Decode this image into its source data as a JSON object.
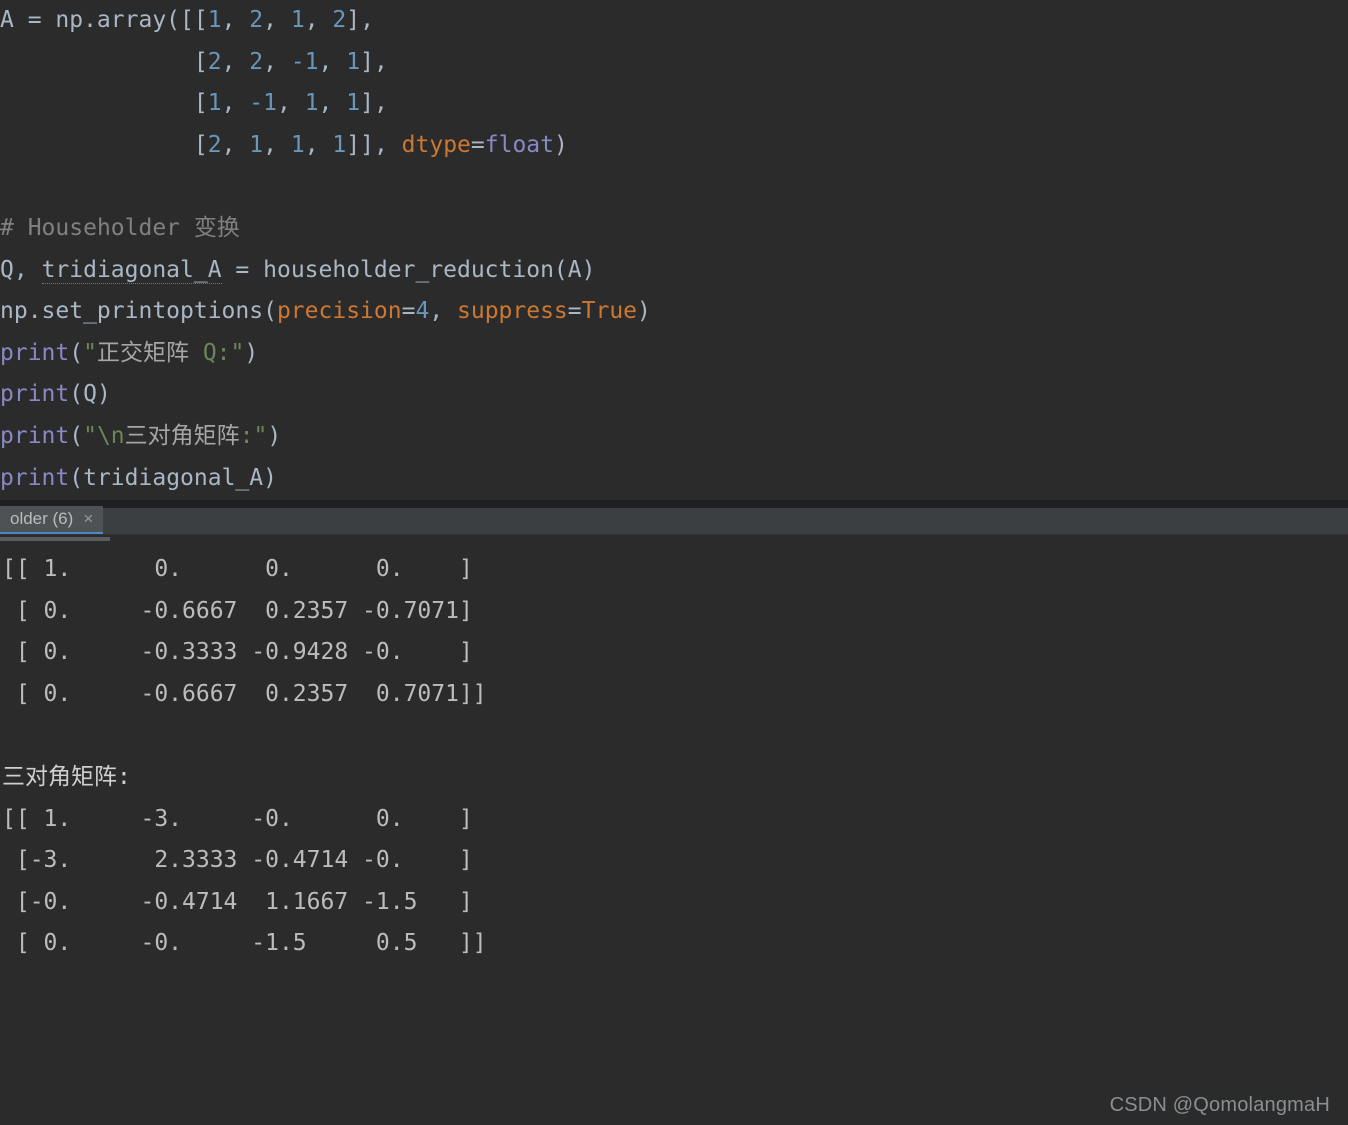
{
  "code": {
    "line1": {
      "prefix": "A = np.array([[",
      "n1": "1",
      "n2": "2",
      "n3": "1",
      "n4": "2",
      "suffix": "],"
    },
    "line2": {
      "pad": "              [",
      "n1": "2",
      "n2": "2",
      "n3": "-1",
      "n4": "1",
      "suffix": "],"
    },
    "line3": {
      "pad": "              [",
      "n1": "1",
      "n2": "-1",
      "n3": "1",
      "n4": "1",
      "suffix": "],"
    },
    "line4": {
      "pad": "              [",
      "n1": "2",
      "n2": "1",
      "n3": "1",
      "n4": "1",
      "mid": "]], ",
      "kw": "dtype",
      "eq": "=",
      "val": "float",
      "end": ")"
    },
    "blank1": "",
    "comment_hash": "# ",
    "comment_en": "Householder ",
    "comment_cn": "变换",
    "line7": {
      "Q": "Q",
      "comma": ", ",
      "tri": "tridiagonal_A",
      "eq": " = ",
      "fn": "householder_reduction",
      "open": "(",
      "arg": "A",
      "close": ")"
    },
    "line8": {
      "pre": "np.set_printoptions(",
      "kw1": "precision",
      "eq1": "=",
      "v1": "4",
      "comma": ", ",
      "kw2": "suppress",
      "eq2": "=",
      "v2": "True",
      "close": ")"
    },
    "line9_print": "print",
    "line9_open": "(",
    "line9_q": "\"",
    "line9_cn": "正交矩阵",
    "line9_q2": " Q:\"",
    "line9_close": ")",
    "line10_print": "print",
    "line10_open": "(",
    "line10_arg": "Q",
    "line10_close": ")",
    "line11_print": "print",
    "line11_open": "(",
    "line11_q": "\"\\n",
    "line11_cn": "三对角矩阵",
    "line11_q2": ":\"",
    "line11_close": ")",
    "line12_print": "print",
    "line12_open": "(",
    "line12_arg": "tridiagonal_A",
    "line12_close": ")"
  },
  "tab": {
    "label": "older (6)",
    "close": "×"
  },
  "output": {
    "q_row1": "[[ 1.      0.      0.      0.    ]",
    "q_row2": " [ 0.     -0.6667  0.2357 -0.7071]",
    "q_row3": " [ 0.     -0.3333 -0.9428 -0.    ]",
    "q_row4": " [ 0.     -0.6667  0.2357  0.7071]]",
    "blank": "",
    "tri_label": "三对角矩阵:",
    "t_row1": "[[ 1.     -3.     -0.      0.    ]",
    "t_row2": " [-3.      2.3333 -0.4714 -0.    ]",
    "t_row3": " [-0.     -0.4714  1.1667 -1.5   ]",
    "t_row4": " [ 0.     -0.     -1.5     0.5   ]]"
  },
  "watermark": "CSDN @QomolangmaH"
}
